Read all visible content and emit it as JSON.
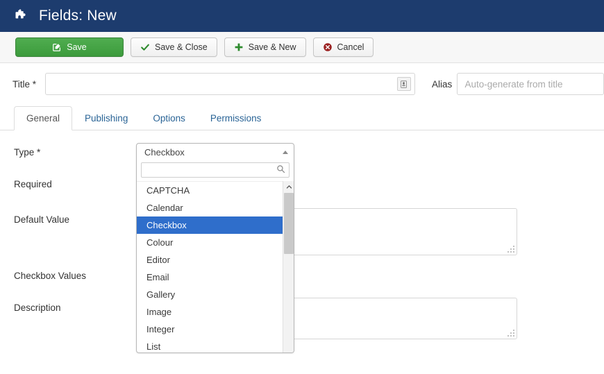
{
  "header": {
    "title": "Fields: New",
    "icon": "puzzle-piece-icon",
    "background": "#1d3c6e"
  },
  "toolbar": {
    "buttons": [
      {
        "label": "Save",
        "icon": "edit-square-icon",
        "style": "primary",
        "color": "#3c9b3c"
      },
      {
        "label": "Save & Close",
        "icon": "check-icon",
        "style": "default",
        "color": "#2e8b2e"
      },
      {
        "label": "Save & New",
        "icon": "plus-icon",
        "style": "default",
        "color": "#2e8b2e"
      },
      {
        "label": "Cancel",
        "icon": "cancel-circle-icon",
        "style": "default",
        "color": "#9b2222"
      }
    ]
  },
  "title_row": {
    "title_label": "Title *",
    "title_value": "",
    "title_placeholder": "",
    "title_badge_icon": "batch-tooltip-icon",
    "alias_label": "Alias",
    "alias_value": "",
    "alias_placeholder": "Auto-generate from title"
  },
  "tabs": [
    {
      "label": "General",
      "active": true
    },
    {
      "label": "Publishing",
      "active": false
    },
    {
      "label": "Options",
      "active": false
    },
    {
      "label": "Permissions",
      "active": false
    }
  ],
  "form": {
    "fields": [
      {
        "label": "Type *"
      },
      {
        "label": "Required"
      },
      {
        "label": "Default Value"
      },
      {
        "label": "Checkbox Values"
      },
      {
        "label": "Description"
      }
    ],
    "textareas": [
      {
        "name": "default-value-textarea",
        "value": ""
      },
      {
        "name": "description-textarea",
        "value": ""
      }
    ]
  },
  "type_dropdown": {
    "selected": "Checkbox",
    "caret_icon": "chevron-up-icon",
    "search_value": "",
    "search_placeholder": "",
    "search_icon": "search-icon",
    "scroll_up_icon": "chevron-up-icon",
    "scroll_down_icon": "chevron-down-icon",
    "highlight_color": "#2f6ecb",
    "options": [
      "CAPTCHA",
      "Calendar",
      "Checkbox",
      "Colour",
      "Editor",
      "Email",
      "Gallery",
      "Image",
      "Integer",
      "List"
    ]
  }
}
